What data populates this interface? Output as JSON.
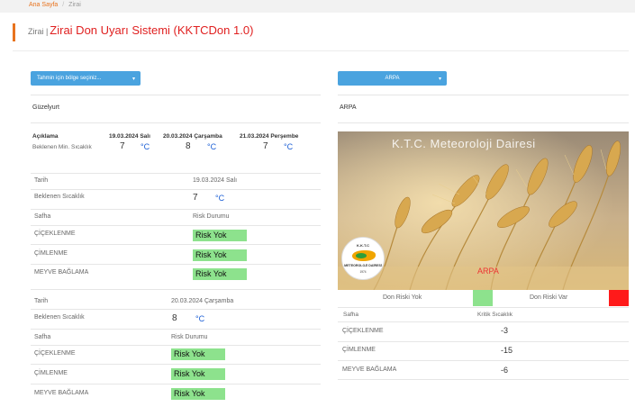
{
  "breadcrumb": {
    "home": "Ana Sayfa",
    "separator": "/",
    "current": "Zirai"
  },
  "header": {
    "prefix": "Zirai |",
    "title": "Zirai Don Uyarı Sistemi (KKTCDon 1.0)"
  },
  "region_select": {
    "label": "Tahmin için bölge seçiniz...",
    "selected": "Güzelyurt"
  },
  "crop_select": {
    "label": "ARPA",
    "selected": "ARPA"
  },
  "summary": {
    "header_label": "Açıklama",
    "days": [
      {
        "date": "19.03.2024 Salı",
        "min": "7",
        "unit": "°C"
      },
      {
        "date": "20.03.2024 Çarşamba",
        "min": "8",
        "unit": "°C"
      },
      {
        "date": "21.03.2024 Perşembe",
        "min": "7",
        "unit": "°C"
      }
    ],
    "min_label": "Beklenen Min. Sıcaklık"
  },
  "forecast_blocks": [
    {
      "date_label": "Tarih",
      "date_value": "19.03.2024 Salı",
      "temp_label": "Beklenen Sıcaklık",
      "temp_value": "7",
      "temp_unit": "°C",
      "stage_label": "Safha",
      "risk_header": "Risk Durumu",
      "stages": [
        {
          "name": "ÇİÇEKLENME",
          "risk": "Risk Yok"
        },
        {
          "name": "ÇİMLENME",
          "risk": "Risk Yok"
        },
        {
          "name": "MEYVE BAĞLAMA",
          "risk": "Risk Yok"
        }
      ]
    },
    {
      "date_label": "Tarih",
      "date_value": "20.03.2024 Çarşamba",
      "temp_label": "Beklenen Sıcaklık",
      "temp_value": "8",
      "temp_unit": "°C",
      "stage_label": "Safha",
      "risk_header": "Risk Durumu",
      "stages": [
        {
          "name": "ÇİÇEKLENME",
          "risk": "Risk Yok"
        },
        {
          "name": "ÇİMLENME",
          "risk": "Risk Yok"
        },
        {
          "name": "MEYVE BAĞLAMA",
          "risk": "Risk Yok"
        }
      ]
    }
  ],
  "image": {
    "watermark": "K.T.C. Meteoroloji Dairesi",
    "caption": "ARPA",
    "logo": {
      "top": "K.K.T.C",
      "middle": "METEOROLOJİ DAİRESİ",
      "bottom": "1974"
    }
  },
  "legend": [
    {
      "label": "Don Riski Yok",
      "color": "#8de28d"
    },
    {
      "label": "Don Riski Var",
      "color": "#ff1a1a"
    }
  ],
  "critical_table": {
    "headers": [
      "Safha",
      "Kritik Sıcaklık"
    ],
    "rows": [
      {
        "stage": "ÇİÇEKLENME",
        "value": "-3"
      },
      {
        "stage": "ÇİMLENME",
        "value": "-15"
      },
      {
        "stage": "MEYVE BAĞLAMA",
        "value": "-6"
      }
    ]
  },
  "colors": {
    "accent": "#e8731e",
    "title": "#e02020",
    "button": "#4aa3df",
    "risk_none": "#8de28d",
    "risk_yes": "#ff1a1a",
    "unit": "#1c5fd6"
  }
}
